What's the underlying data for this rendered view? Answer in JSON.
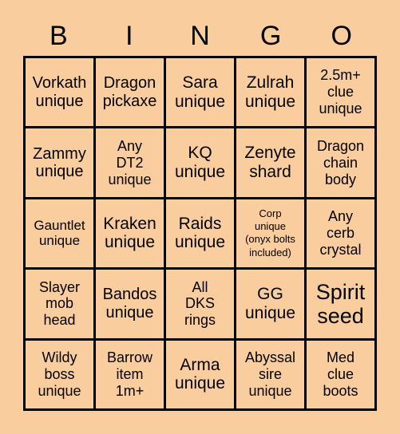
{
  "card": {
    "background_color": "#facd9e",
    "border_color": "#000000",
    "text_color": "#000000",
    "header_letters": [
      "B",
      "I",
      "N",
      "G",
      "O"
    ],
    "columns": 5,
    "rows": 5,
    "cells": [
      {
        "text": "Vorkath\nunique",
        "size": "md"
      },
      {
        "text": "Dragon\npickaxe",
        "size": "md"
      },
      {
        "text": "Sara\nunique",
        "size": "lg"
      },
      {
        "text": "Zulrah\nunique",
        "size": "lg"
      },
      {
        "text": "2.5m+\nclue\nunique",
        "size": "sm"
      },
      {
        "text": "Zammy\nunique",
        "size": "md"
      },
      {
        "text": "Any\nDT2\nunique",
        "size": "sm"
      },
      {
        "text": "KQ\nunique",
        "size": "lg"
      },
      {
        "text": "Zenyte\nshard",
        "size": "lg"
      },
      {
        "text": "Dragon\nchain\nbody",
        "size": "sm"
      },
      {
        "text": "Gauntlet\nunique",
        "size": "xs"
      },
      {
        "text": "Kraken\nunique",
        "size": "lg"
      },
      {
        "text": "Raids\nunique",
        "size": "lg"
      },
      {
        "text": "Corp\nunique\n(onyx bolts\nincluded)",
        "size": "tiny"
      },
      {
        "text": "Any\ncerb\ncrystal",
        "size": "sm"
      },
      {
        "text": "Slayer\nmob\nhead",
        "size": "sm"
      },
      {
        "text": "Bandos\nunique",
        "size": "md"
      },
      {
        "text": "All\nDKS\nrings",
        "size": "sm"
      },
      {
        "text": "GG\nunique",
        "size": "lg"
      },
      {
        "text": "Spirit\nseed",
        "size": "xl"
      },
      {
        "text": "Wildy\nboss\nunique",
        "size": "sm"
      },
      {
        "text": "Barrow\nitem\n1m+",
        "size": "sm"
      },
      {
        "text": "Arma\nunique",
        "size": "lg"
      },
      {
        "text": "Abyssal\nsire\nunique",
        "size": "sm"
      },
      {
        "text": "Med\nclue\nboots",
        "size": "sm"
      }
    ]
  }
}
